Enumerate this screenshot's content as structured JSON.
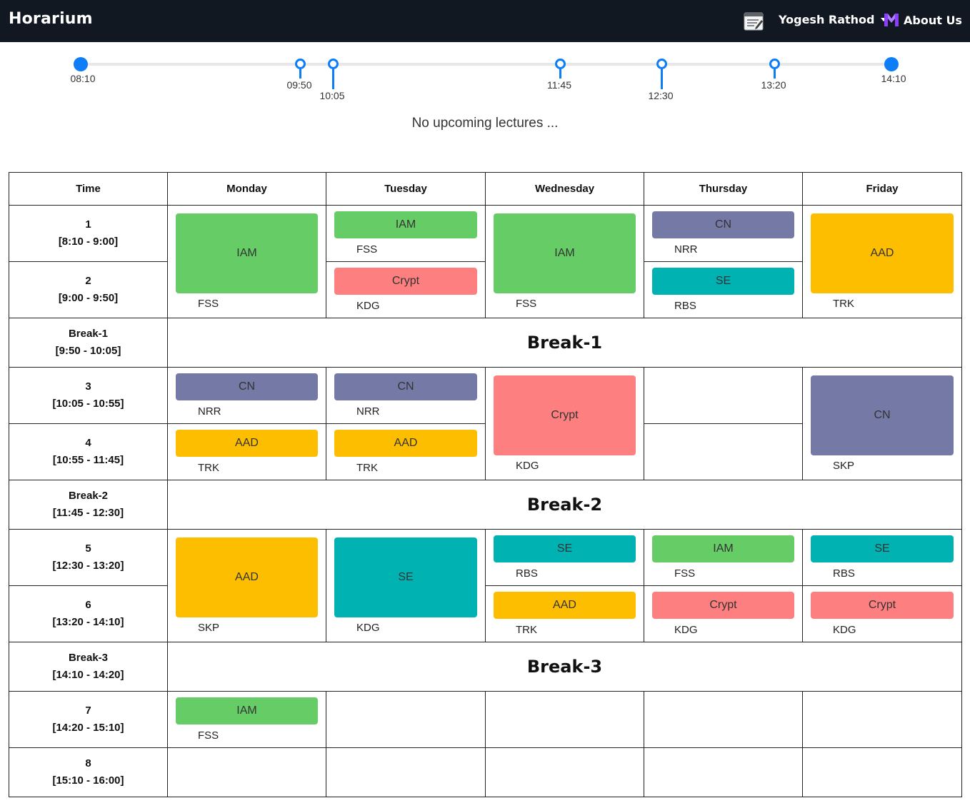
{
  "app": {
    "brand": "Horarium",
    "user_name": "Yogesh Rathod",
    "about_label": "About Us",
    "icons": {
      "notes": "notes-icon",
      "caret": "caret-down-icon",
      "about_logo": "brand-logo-icon"
    },
    "colors": {
      "navbar": "#111821",
      "accent": "#0d7ef7"
    }
  },
  "timeline": {
    "markers": [
      {
        "time": "08:10",
        "kind": "start"
      },
      {
        "time": "09:50",
        "kind": "break-start"
      },
      {
        "time": "10:05",
        "kind": "break-end"
      },
      {
        "time": "11:45",
        "kind": "break-start"
      },
      {
        "time": "12:30",
        "kind": "break-end"
      },
      {
        "time": "13:20",
        "kind": "break-start"
      },
      {
        "time": "14:10",
        "kind": "end"
      }
    ],
    "status": "No upcoming lectures ..."
  },
  "timetable": {
    "headers": [
      "Time",
      "Monday",
      "Tuesday",
      "Wednesday",
      "Thursday",
      "Friday"
    ],
    "subject_colors": {
      "IAM": "#66cd66",
      "CN": "#7479a6",
      "AAD": "#febe00",
      "Crypt": "#fe7f7f",
      "SE": "#00b2b2"
    },
    "slots": [
      {
        "label": "1",
        "time": "[8:10 - 9:00]"
      },
      {
        "label": "2",
        "time": "[9:00 - 9:50]"
      },
      {
        "label": "Break-1",
        "time": "[9:50 - 10:05]"
      },
      {
        "label": "3",
        "time": "[10:05 - 10:55]"
      },
      {
        "label": "4",
        "time": "[10:55 - 11:45]"
      },
      {
        "label": "Break-2",
        "time": "[11:45 - 12:30]"
      },
      {
        "label": "5",
        "time": "[12:30 - 13:20]"
      },
      {
        "label": "6",
        "time": "[13:20 - 14:10]"
      },
      {
        "label": "Break-3",
        "time": "[14:10 - 14:20]"
      },
      {
        "label": "7",
        "time": "[14:20 - 15:10]"
      },
      {
        "label": "8",
        "time": "[15:10 - 16:00]"
      }
    ],
    "breaks": [
      "Break-1",
      "Break-2",
      "Break-3"
    ],
    "lectures": {
      "mon_1": {
        "subject": "IAM",
        "prof": "FSS"
      },
      "tue_1": {
        "subject": "IAM",
        "prof": "FSS"
      },
      "tue_2": {
        "subject": "Crypt",
        "prof": "KDG"
      },
      "wed_1": {
        "subject": "IAM",
        "prof": "FSS"
      },
      "thu_1": {
        "subject": "CN",
        "prof": "NRR"
      },
      "thu_2": {
        "subject": "SE",
        "prof": "RBS"
      },
      "fri_1": {
        "subject": "AAD",
        "prof": "TRK"
      },
      "mon_3": {
        "subject": "CN",
        "prof": "NRR"
      },
      "mon_4": {
        "subject": "AAD",
        "prof": "TRK"
      },
      "tue_3": {
        "subject": "CN",
        "prof": "NRR"
      },
      "tue_4": {
        "subject": "AAD",
        "prof": "TRK"
      },
      "wed_3": {
        "subject": "Crypt",
        "prof": "KDG"
      },
      "fri_3": {
        "subject": "CN",
        "prof": "SKP"
      },
      "mon_5": {
        "subject": "AAD",
        "prof": "SKP"
      },
      "tue_5": {
        "subject": "SE",
        "prof": "KDG"
      },
      "wed_5": {
        "subject": "SE",
        "prof": "RBS"
      },
      "wed_6": {
        "subject": "AAD",
        "prof": "TRK"
      },
      "thu_5": {
        "subject": "IAM",
        "prof": "FSS"
      },
      "thu_6": {
        "subject": "Crypt",
        "prof": "KDG"
      },
      "fri_5": {
        "subject": "SE",
        "prof": "RBS"
      },
      "fri_6": {
        "subject": "Crypt",
        "prof": "KDG"
      },
      "mon_7": {
        "subject": "IAM",
        "prof": "FSS"
      }
    }
  }
}
